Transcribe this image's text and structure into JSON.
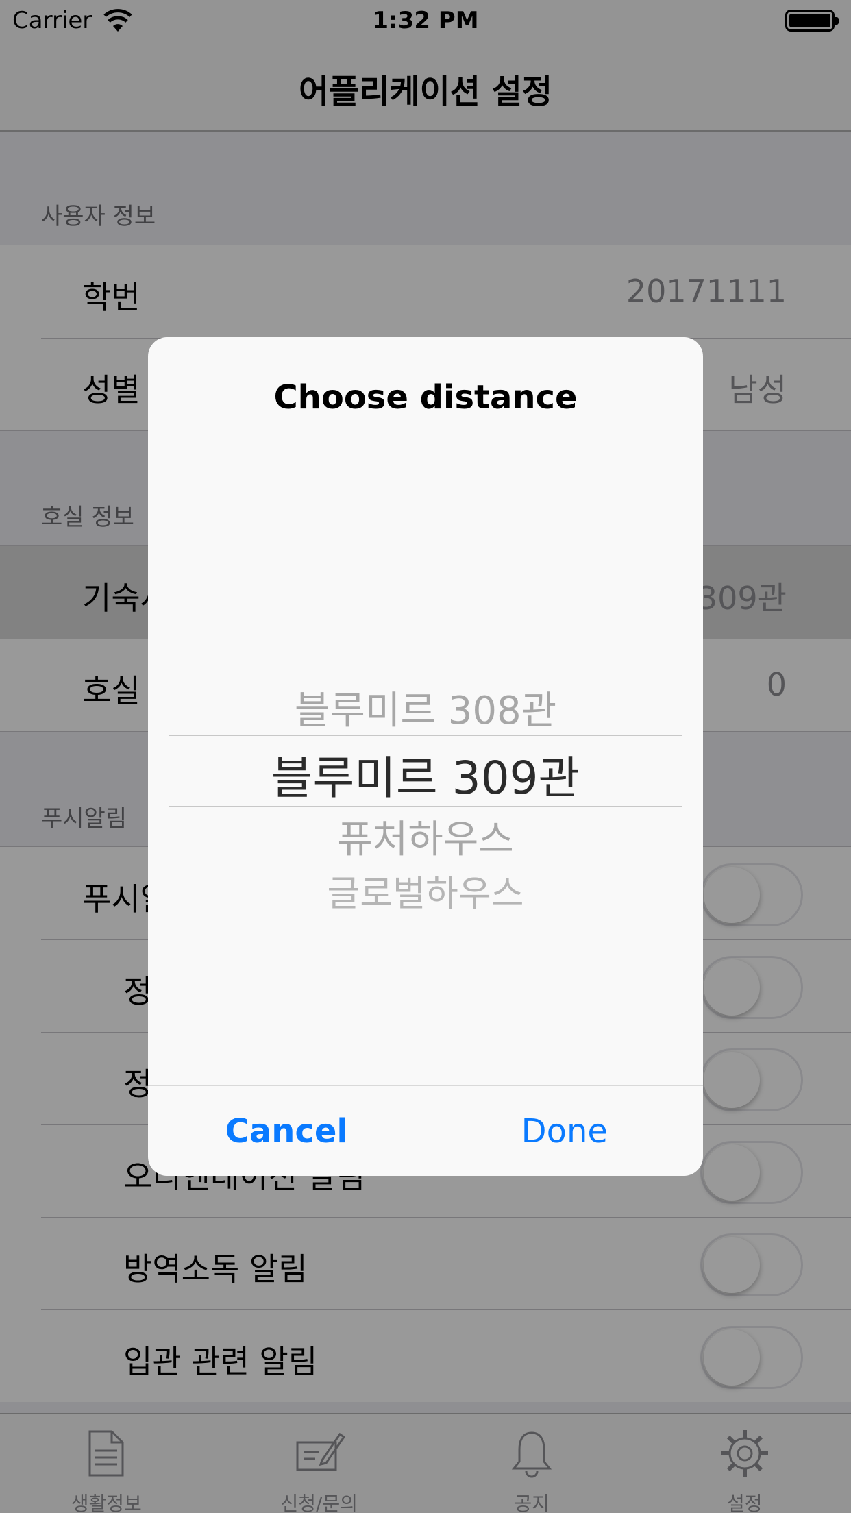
{
  "status_bar": {
    "carrier": "Carrier",
    "time": "1:32 PM"
  },
  "nav": {
    "title": "어플리케이션 설정"
  },
  "sections": {
    "user": {
      "header": "사용자 정보",
      "rows": [
        {
          "label": "학번",
          "value": "20171111"
        },
        {
          "label": "성별",
          "value": "남성"
        }
      ]
    },
    "room": {
      "header": "호실 정보",
      "rows": [
        {
          "label": "기숙사",
          "value": "블루미르 309관"
        },
        {
          "label": "호실",
          "value": "0"
        }
      ]
    },
    "push": {
      "header": "푸시알림",
      "rows": [
        {
          "label": "푸시알림",
          "on": false
        },
        {
          "label": "정",
          "on": false
        },
        {
          "label": "정",
          "on": false
        },
        {
          "label": "오리엔테이션 알림",
          "on": false
        },
        {
          "label": "방역소독 알림",
          "on": false
        },
        {
          "label": "입관 관련 알림",
          "on": false
        }
      ]
    }
  },
  "tabs": [
    {
      "label": "생활정보",
      "icon": "document-icon"
    },
    {
      "label": "신청/문의",
      "icon": "form-pen-icon"
    },
    {
      "label": "공지",
      "icon": "bell-icon"
    },
    {
      "label": "설정",
      "icon": "gear-icon"
    }
  ],
  "alert": {
    "title": "Choose distance",
    "options": [
      "블루미르 308관",
      "블루미르 309관",
      "퓨처하우스",
      "글로벌하우스"
    ],
    "selected": "블루미르 309관",
    "cancel": "Cancel",
    "done": "Done"
  },
  "colors": {
    "accent": "#0a7aff",
    "background": "#efeff4"
  }
}
